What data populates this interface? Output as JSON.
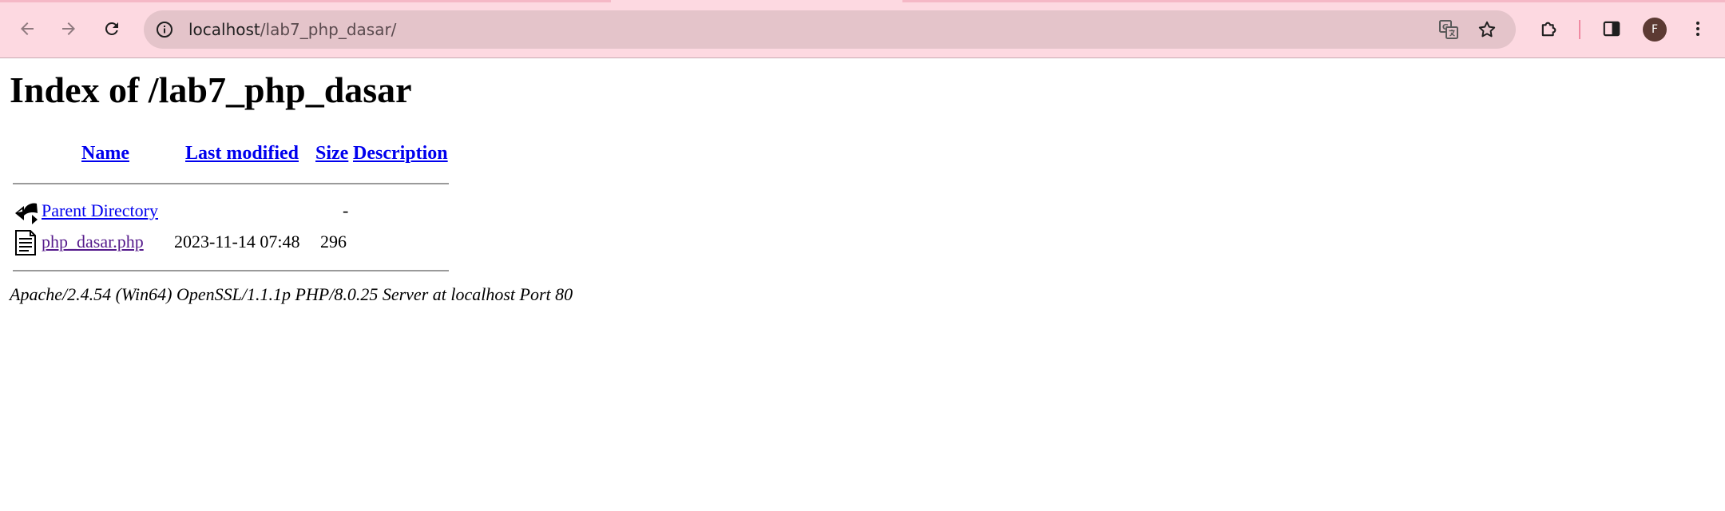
{
  "browser": {
    "url_host": "localhost",
    "url_path": "/lab7_php_dasar/",
    "profile_initial": "F",
    "icons": {
      "back": "arrow-left-icon",
      "forward": "arrow-right-icon",
      "reload": "reload-icon",
      "site_info": "info-icon",
      "translate": "translate-icon",
      "bookmark": "star-icon",
      "extensions": "puzzle-icon",
      "side_panel": "side-panel-icon",
      "menu": "kebab-menu-icon"
    },
    "colors": {
      "toolbar": "#fdd9e1",
      "omnibox": "#e4c4ca",
      "avatar": "#5c3a33"
    }
  },
  "page": {
    "title": "Index of /lab7_php_dasar",
    "columns": {
      "name": "Name",
      "last_modified": "Last modified",
      "size": "Size",
      "description": "Description"
    },
    "rows": [
      {
        "icon": "back-arrow-icon",
        "name": "Parent Directory",
        "last_modified": "",
        "size": "-",
        "description": ""
      },
      {
        "icon": "text-file-icon",
        "name": "php_dasar.php",
        "last_modified": "2023-11-14 07:48",
        "size": "296",
        "description": ""
      }
    ],
    "server_signature": "Apache/2.4.54 (Win64) OpenSSL/1.1.1p PHP/8.0.25 Server at localhost Port 80"
  }
}
